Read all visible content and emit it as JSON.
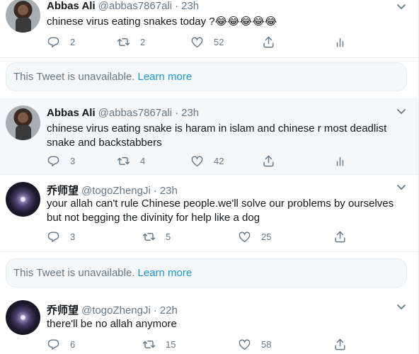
{
  "tweets": [
    {
      "name": "Abbas Ali",
      "handle": "@abbas7867ali",
      "dot": "·",
      "time": "23h",
      "text": "chinese virus eating snakes today ?",
      "emoji": "😂😂😂😂😂",
      "replies": "2",
      "retweets": "2",
      "likes": "52"
    },
    {
      "name": "Abbas Ali",
      "handle": "@abbas7867ali",
      "dot": "·",
      "time": "23h",
      "text": "chinese virus eating snake is haram in islam and chinese r most deadlist snake and backstabbers",
      "replies": "3",
      "retweets": "4",
      "likes": "42"
    },
    {
      "name": "乔师望",
      "handle": "@togoZhengJi",
      "dot": "·",
      "time": "23h",
      "text": "your allah can't rule Chinese people.we'll solve our problems by ourselves but not begging the divinity for help like a dog",
      "replies": "3",
      "retweets": "5",
      "likes": "25"
    },
    {
      "name": "乔师望",
      "handle": "@togoZhengJi",
      "dot": "·",
      "time": "22h",
      "text": "there'll be no allah anymore",
      "replies": "6",
      "retweets": "15",
      "likes": "58"
    }
  ],
  "unavailable": {
    "text": "This Tweet is unavailable.",
    "link": "Learn more"
  },
  "icons": {
    "reply": "reply-icon",
    "retweet": "retweet-icon",
    "like": "heart-icon",
    "share": "share-icon",
    "analytics": "analytics-icon",
    "more": "chevron-down-icon"
  },
  "colors": {
    "muted": "#657786",
    "link": "#1b95e0",
    "highlight_bg": "#f5f8fa",
    "border": "#e6ecf0"
  }
}
